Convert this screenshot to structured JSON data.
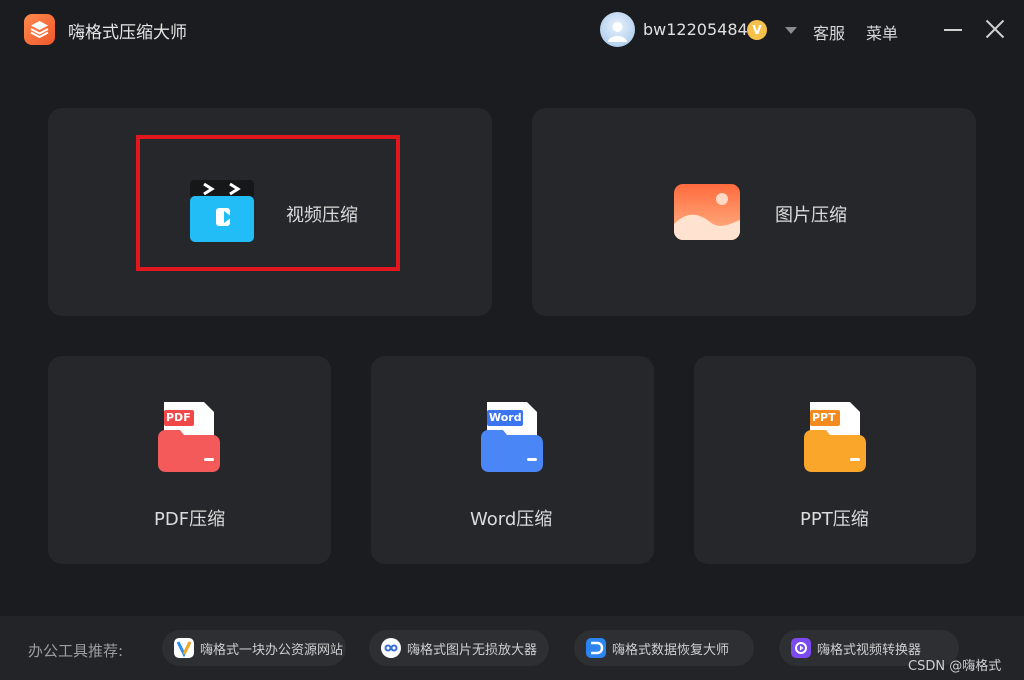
{
  "app": {
    "title": "嗨格式压缩大师"
  },
  "user": {
    "name": "bw12205484",
    "vip_badge": "V"
  },
  "titlebar": {
    "service_label": "客服",
    "menu_label": "菜单"
  },
  "cards": {
    "video": {
      "label": "视频压缩"
    },
    "image": {
      "label": "图片压缩"
    },
    "pdf": {
      "label": "PDF压缩",
      "badge": "PDF"
    },
    "word": {
      "label": "Word压缩",
      "badge": "Word"
    },
    "ppt": {
      "label": "PPT压缩",
      "badge": "PPT"
    }
  },
  "footer": {
    "label": "办公工具推荐:",
    "items": [
      {
        "label": "嗨格式一块办公资源网站"
      },
      {
        "label": "嗨格式图片无损放大器"
      },
      {
        "label": "嗨格式数据恢复大师"
      },
      {
        "label": "嗨格式视频转换器"
      }
    ]
  },
  "watermark": "CSDN @嗨格式",
  "colors": {
    "background": "#1b1c1f",
    "card": "#26272b",
    "highlight": "#e0171c",
    "accent_orange": "#f0572b"
  }
}
